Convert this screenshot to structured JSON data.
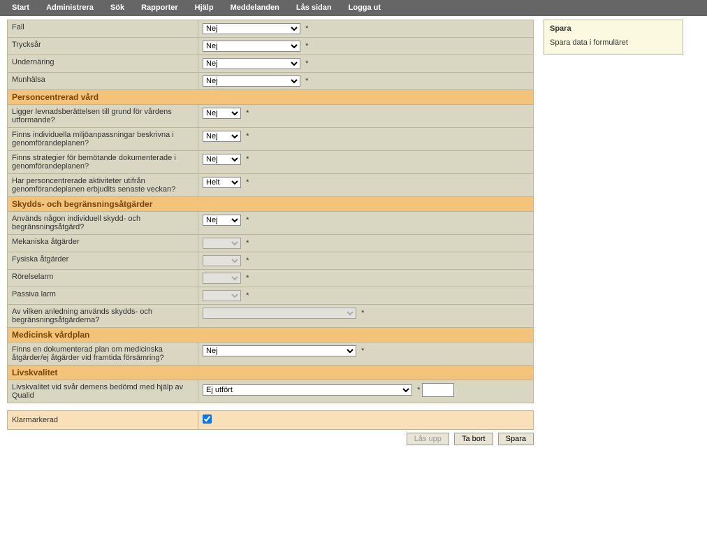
{
  "menu": {
    "items": [
      "Start",
      "Administrera",
      "Sök",
      "Rapporter",
      "Hjälp",
      "Meddelanden",
      "Lås sidan",
      "Logga ut"
    ]
  },
  "risk": {
    "rows": [
      {
        "label": "Fall",
        "value": "Nej"
      },
      {
        "label": "Trycksår",
        "value": "Nej"
      },
      {
        "label": "Undernäring",
        "value": "Nej"
      },
      {
        "label": "Munhälsa",
        "value": "Nej"
      }
    ]
  },
  "sections": {
    "personcentrerad": {
      "title": "Personcentrerad vård",
      "rows": [
        {
          "label": "Ligger levnadsberättelsen till grund för vårdens utformande?",
          "value": "Nej"
        },
        {
          "label": "Finns individuella miljöanpassningar beskrivna i genomförandeplanen?",
          "value": "Nej"
        },
        {
          "label": "Finns strategier för bemötande dokumenterade i genomförandeplanen?",
          "value": "Nej"
        },
        {
          "label": "Har personcentrerade aktiviteter utifrån genomförandeplanen erbjudits senaste veckan?",
          "value": "Helt"
        }
      ]
    },
    "skydd": {
      "title": "Skydds- och begränsningsåtgärder",
      "rows": [
        {
          "label": "Används någon individuell skydd- och begränsningsåtgärd?",
          "value": "Nej",
          "disabled": false
        },
        {
          "label": "Mekaniska åtgärder",
          "value": "",
          "disabled": true
        },
        {
          "label": "Fysiska åtgärder",
          "value": "",
          "disabled": true
        },
        {
          "label": "Rörelselarm",
          "value": "",
          "disabled": true
        },
        {
          "label": "Passiva larm",
          "value": "",
          "disabled": true
        }
      ],
      "reason": {
        "label": "Av vilken anledning används skydds- och begränsningsåtgärderna?",
        "value": ""
      }
    },
    "medicinsk": {
      "title": "Medicinsk vårdplan",
      "row": {
        "label": "Finns en dokumenterad plan om medicinska åtgärder/ej åtgärder vid framtida försämring?",
        "value": "Nej"
      }
    },
    "livskvalitet": {
      "title": "Livskvalitet",
      "row": {
        "label": "Livskvalitet vid svår demens bedömd med hjälp av Qualid",
        "value": "Ej utfört",
        "extra": ""
      }
    }
  },
  "klar": {
    "label": "Klarmarkerad",
    "checked": true
  },
  "buttons": {
    "lasupp": "Lås upp",
    "tabort": "Ta bort",
    "spara": "Spara"
  },
  "help": {
    "title": "Spara",
    "text": "Spara data i formuläret"
  },
  "asterisk": "*"
}
